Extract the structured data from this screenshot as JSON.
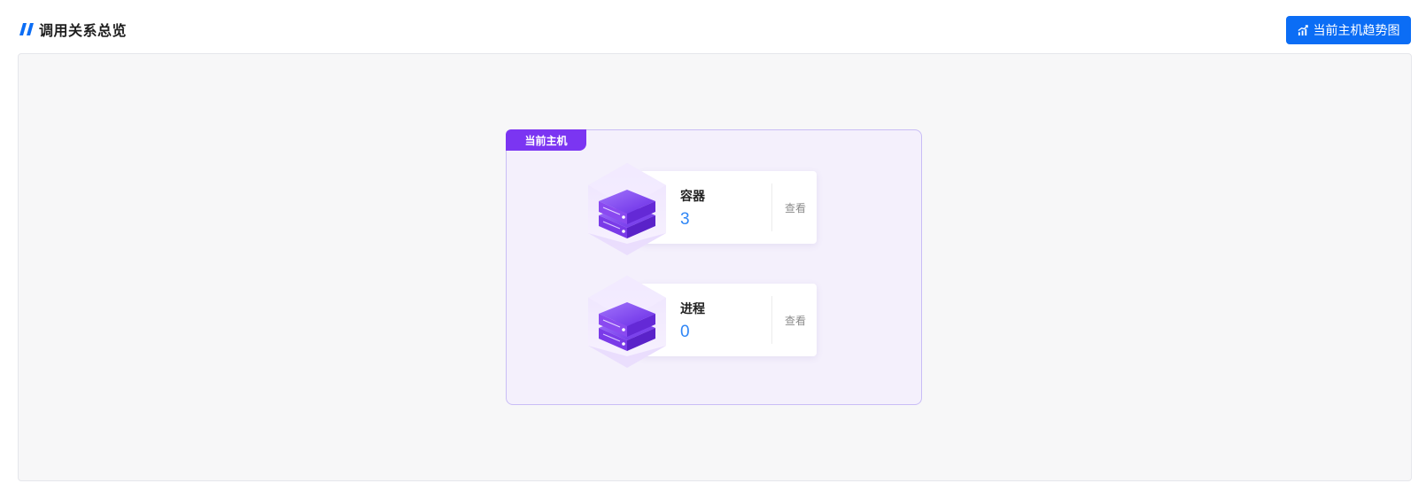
{
  "header": {
    "title": "调用关系总览",
    "trend_button_label": "当前主机趋势图"
  },
  "host": {
    "tag": "当前主机",
    "items": [
      {
        "label": "容器",
        "value": "3",
        "action": "查看",
        "icon": "server-stack-icon"
      },
      {
        "label": "进程",
        "value": "0",
        "action": "查看",
        "icon": "server-stack-icon"
      }
    ]
  },
  "colors": {
    "primary": "#0b6df5",
    "host_tag": "#7b35f2",
    "host_bg": "#f4f0fc",
    "value": "#2f86f6"
  }
}
